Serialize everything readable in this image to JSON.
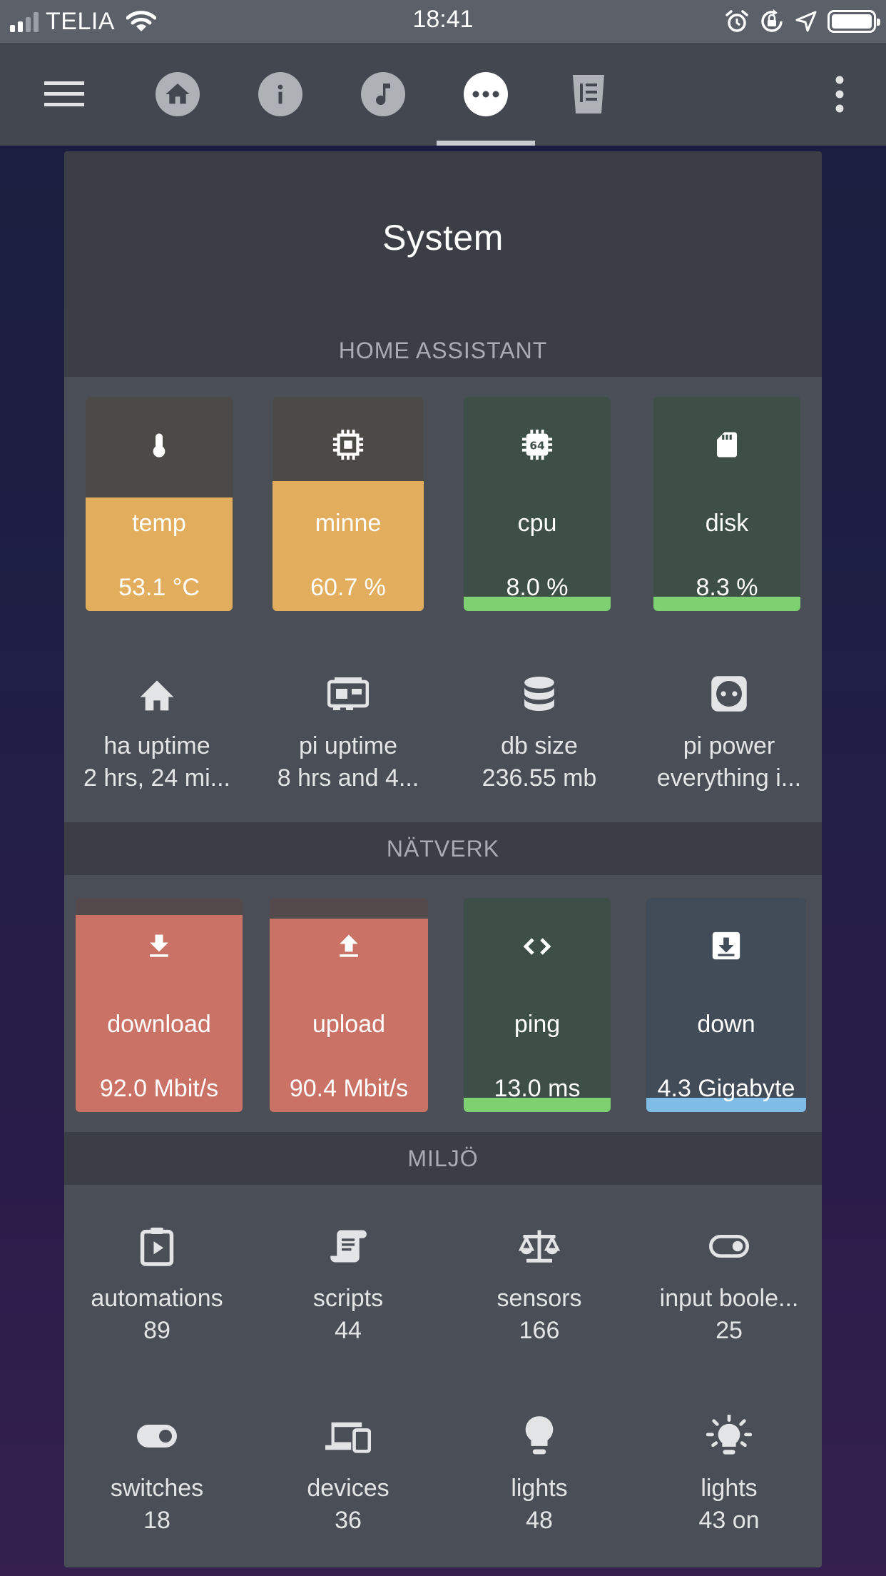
{
  "status_bar": {
    "carrier": "TELIA",
    "time": "18:41"
  },
  "toolbar": {
    "tabs": [
      {
        "icon": "home-icon"
      },
      {
        "icon": "info-icon"
      },
      {
        "icon": "music-icon"
      },
      {
        "icon": "more-horiz-icon",
        "active": true
      },
      {
        "icon": "clipboard-icon"
      }
    ]
  },
  "card": {
    "title": "System"
  },
  "home_assistant": {
    "title": "HOME ASSISTANT",
    "tiles": [
      {
        "name": "temp",
        "value": "53.1 °C",
        "icon": "thermometer-icon",
        "fill_percent": 53.1,
        "color": "#e2ae5e"
      },
      {
        "name": "minne",
        "value": "60.7 %",
        "icon": "memory-icon",
        "fill_percent": 60.7,
        "color": "#e2ae5e"
      },
      {
        "name": "cpu",
        "value": "8.0 %",
        "icon": "chip-64-icon",
        "fill_percent": 8.0,
        "color": "#7ed071"
      },
      {
        "name": "disk",
        "value": "8.3 %",
        "icon": "sd-card-icon",
        "fill_percent": 8.3,
        "color": "#7ed071"
      }
    ],
    "stats": [
      {
        "name": "ha uptime",
        "value": "2 hrs, 24 mi...",
        "icon": "home-icon"
      },
      {
        "name": "pi uptime",
        "value": "8 hrs and 4...",
        "icon": "raspberry-pi-board-icon"
      },
      {
        "name": "db size",
        "value": "236.55 mb",
        "icon": "database-icon"
      },
      {
        "name": "pi power",
        "value": "everything i...",
        "icon": "power-socket-icon"
      }
    ]
  },
  "network": {
    "title": "NÄTVERK",
    "tiles": [
      {
        "name": "download",
        "value": "92.0 Mbit/s",
        "icon": "download-icon",
        "fill_percent": 92.0,
        "color": "#cb7266"
      },
      {
        "name": "upload",
        "value": "90.4 Mbit/s",
        "icon": "upload-icon",
        "fill_percent": 90.4,
        "color": "#cb7266"
      },
      {
        "name": "ping",
        "value": "13.0 ms",
        "icon": "code-icon",
        "fill_percent": 13.0,
        "color": "#7ed071"
      },
      {
        "name": "down",
        "value": "4.3 Gigabyte",
        "icon": "download-box-icon",
        "fill_percent": 4.3,
        "color": "#7fbce6"
      }
    ]
  },
  "environment": {
    "title": "MILJÖ",
    "stats": [
      {
        "name": "automations",
        "value": "89",
        "icon": "clipboard-play-icon"
      },
      {
        "name": "scripts",
        "value": "44",
        "icon": "script-icon"
      },
      {
        "name": "sensors",
        "value": "166",
        "icon": "scale-balance-icon"
      },
      {
        "name": "input boole...",
        "value": "25",
        "icon": "toggle-off-icon"
      },
      {
        "name": "switches",
        "value": "18",
        "icon": "toggle-switch-icon"
      },
      {
        "name": "devices",
        "value": "36",
        "icon": "devices-icon"
      },
      {
        "name": "lights",
        "value": "48",
        "icon": "lightbulb-icon"
      },
      {
        "name": "lights",
        "value": "43 on",
        "icon": "lightbulb-on-icon"
      }
    ]
  }
}
